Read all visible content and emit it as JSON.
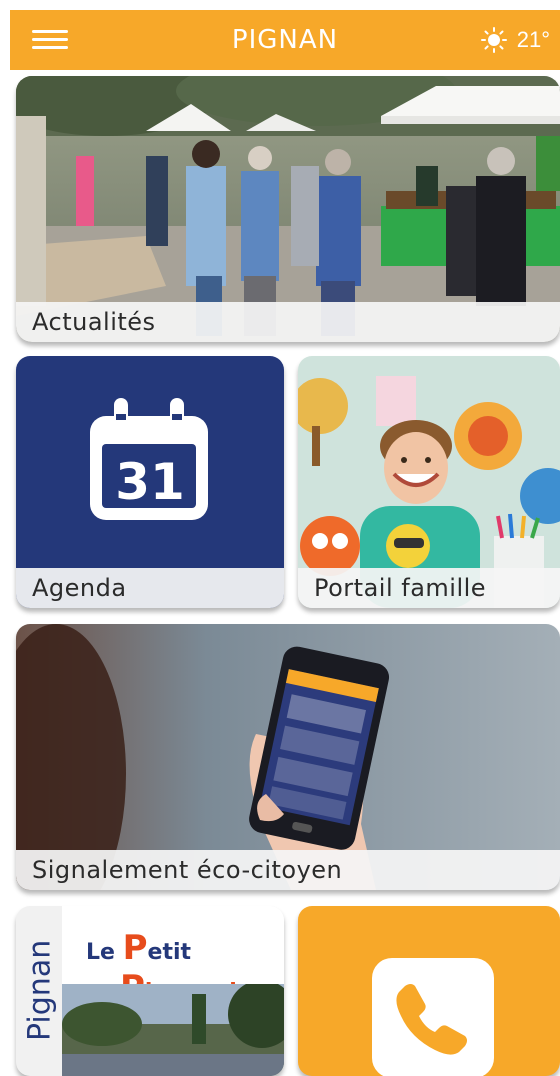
{
  "app": {
    "title": "PIGNAN",
    "menu_icon": "hamburger-icon",
    "weather": {
      "icon": "sun-icon",
      "temperature": "21°"
    },
    "accent_color": "#f7a829",
    "brand_blue": "#24387a"
  },
  "tiles": {
    "actualites": {
      "label": "Actualités"
    },
    "agenda": {
      "label": "Agenda",
      "icon": "calendar-icon",
      "day": "31"
    },
    "portail": {
      "label": "Portail famille"
    },
    "signalement": {
      "label": "Signalement éco-citoyen",
      "icon": "smartphone-icon"
    },
    "petit_pignanais": {
      "side_text": "Pignan",
      "mast_le": "Le",
      "mast_p": "P",
      "mast_etit": "etit",
      "mast_i": "P",
      "mast_ignanais": "ignanais"
    },
    "contact": {
      "icon": "phone-icon"
    }
  }
}
